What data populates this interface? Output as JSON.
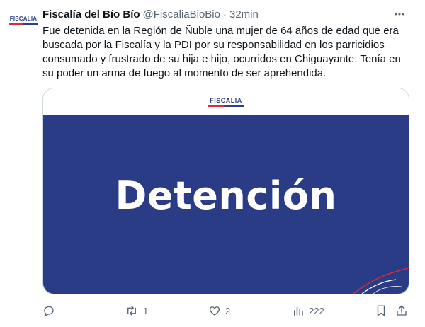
{
  "avatar": {
    "logo_text": "FISCALIA"
  },
  "tweet": {
    "author_name": "Fiscalía del Bío Bío",
    "handle": "@FiscaliaBioBio",
    "separator": "·",
    "time": "32min",
    "text": "Fue detenida en la Región de Ñuble una mujer de 64 años de edad que era buscada por la Fiscalía y la PDI por su responsabilidad en los parricidios consumado y frustrado de su hija e hijo, ocurridos en Chiguayante. Tenía en su poder un arma de fuego al momento de ser aprehendida."
  },
  "card": {
    "logo_text": "FISCALIA",
    "title": "Detención"
  },
  "actions": {
    "reply_count": "",
    "retweet_count": "1",
    "like_count": "2",
    "views_count": "222"
  },
  "icons": [
    "more-icon",
    "reply-icon",
    "retweet-icon",
    "like-icon",
    "views-icon",
    "bookmark-icon",
    "share-icon"
  ],
  "colors": {
    "brand_blue": "#2b3c86",
    "brand_red": "#d92b3a",
    "muted_text": "#536471"
  }
}
